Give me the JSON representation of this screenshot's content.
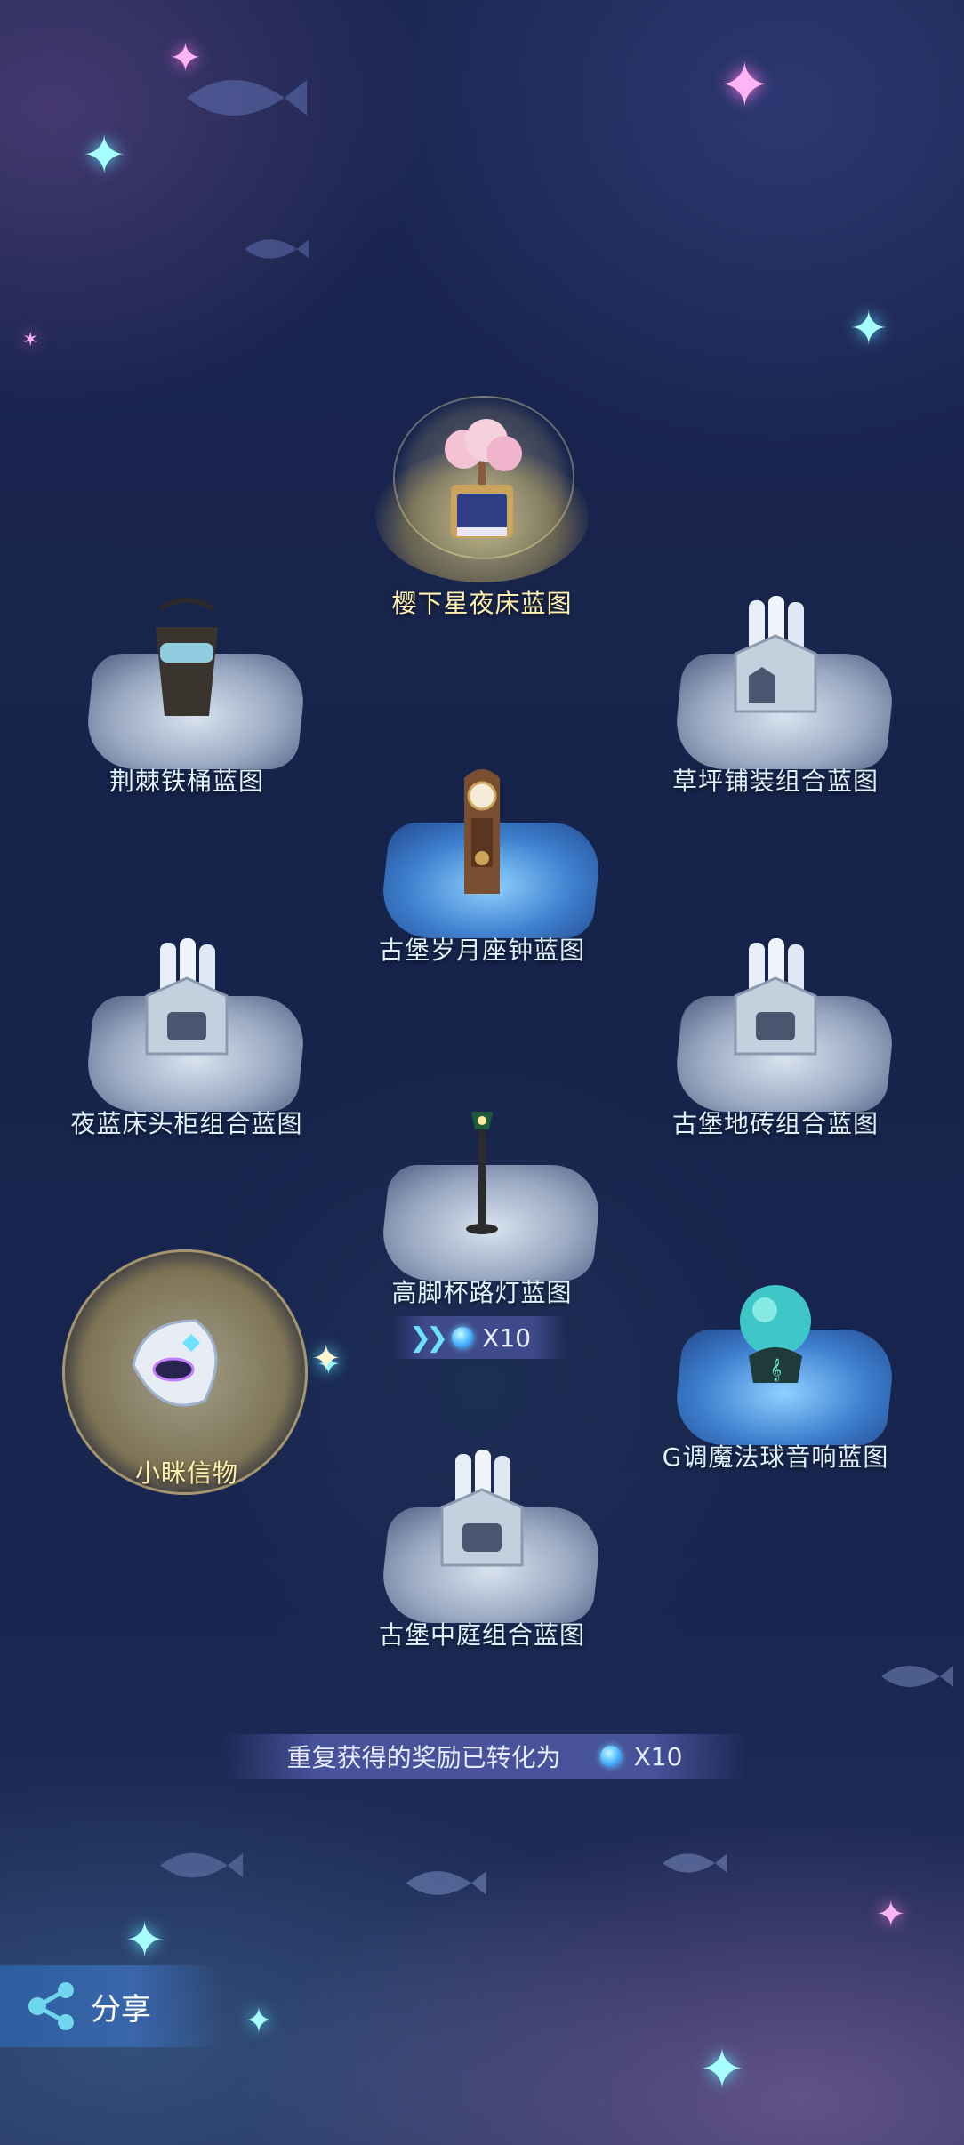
{
  "rewards": [
    {
      "label": "樱下星夜床蓝图",
      "rarity": "gold",
      "icon": "sakura-bed-icon"
    },
    {
      "label": "荆棘铁桶蓝图",
      "rarity": "silver",
      "icon": "iron-bucket-icon"
    },
    {
      "label": "草坪铺装组合蓝图",
      "rarity": "silver",
      "icon": "blueprint-box-icon"
    },
    {
      "label": "古堡岁月座钟蓝图",
      "rarity": "blue",
      "icon": "grandfather-clock-icon"
    },
    {
      "label": "夜蓝床头柜组合蓝图",
      "rarity": "silver",
      "icon": "blueprint-box-icon"
    },
    {
      "label": "古堡地砖组合蓝图",
      "rarity": "silver",
      "icon": "blueprint-box-icon"
    },
    {
      "label": "高脚杯路灯蓝图",
      "rarity": "silver",
      "icon": "street-lamp-icon",
      "duplicate_badge": "X10"
    },
    {
      "label": "小眯信物",
      "rarity": "gold",
      "icon": "token-icon"
    },
    {
      "label": "G调魔法球音响蓝图",
      "rarity": "blue",
      "icon": "magic-orb-speaker-icon"
    },
    {
      "label": "古堡中庭组合蓝图",
      "rarity": "silver",
      "icon": "blueprint-box-icon"
    }
  ],
  "notice": {
    "text": "重复获得的奖励已转化为",
    "amount": "X10"
  },
  "share": {
    "label": "分享"
  },
  "colors": {
    "background": "#1a2650",
    "gold": "#fff2b0",
    "label": "#dff3ff",
    "accent": "#6fe0ff"
  }
}
